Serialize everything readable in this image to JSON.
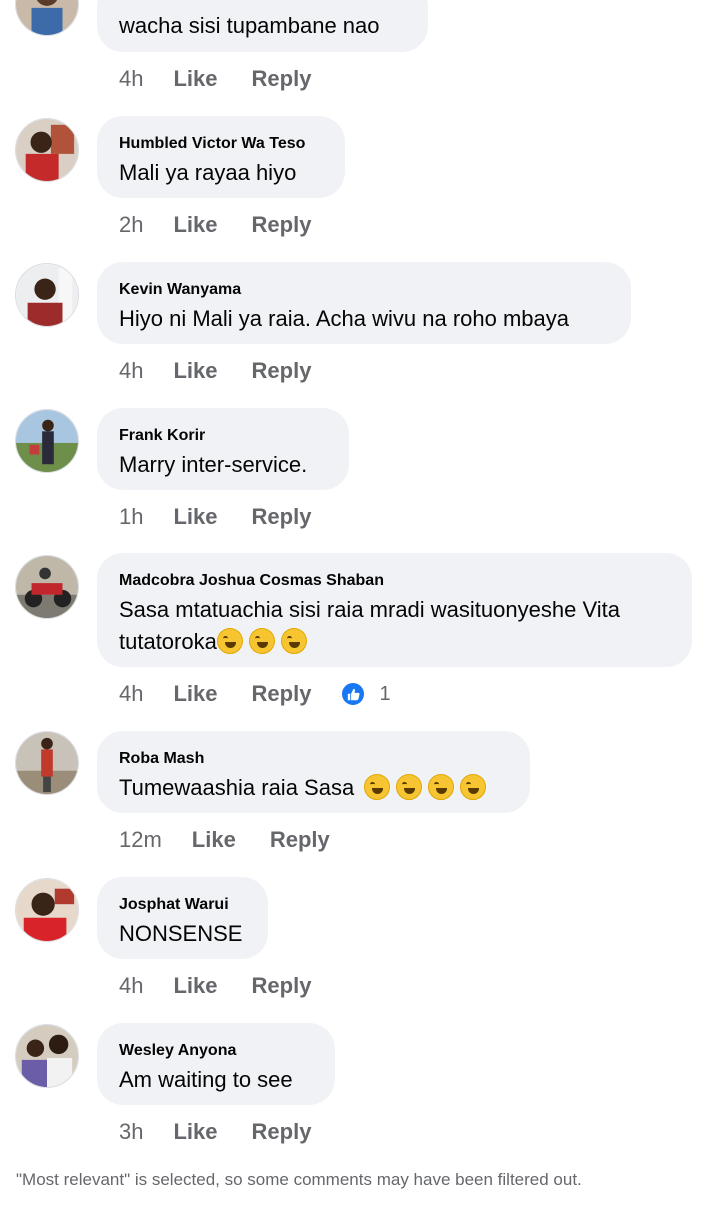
{
  "comments": [
    {
      "author": "",
      "text": "wacha sisi tupambane nao",
      "time": "4h",
      "like": "Like",
      "reply": "Reply"
    },
    {
      "author": "Humbled Victor Wa Teso",
      "text": "Mali ya rayaa hiyo",
      "time": "2h",
      "like": "Like",
      "reply": "Reply"
    },
    {
      "author": "Kevin Wanyama",
      "text": "Hiyo ni Mali ya raia. Acha wivu na roho mbaya",
      "time": "4h",
      "like": "Like",
      "reply": "Reply"
    },
    {
      "author": "Frank Korir",
      "text": "Marry inter-service.",
      "time": "1h",
      "like": "Like",
      "reply": "Reply"
    },
    {
      "author": "Madcobra Joshua Cosmas Shaban",
      "text_line1": "Sasa mtatuachia sisi raia mradi wasituonyeshe Vita",
      "text_line2": "tutatoroka",
      "time": "4h",
      "like": "Like",
      "reply": "Reply",
      "reaction_count": "1"
    },
    {
      "author": "Roba Mash",
      "text": "Tumewaashia raia Sasa",
      "time": "12m",
      "like": "Like",
      "reply": "Reply"
    },
    {
      "author": "Josphat Warui",
      "text": "NONSENSE",
      "time": "4h",
      "like": "Like",
      "reply": "Reply"
    },
    {
      "author": "Wesley Anyona",
      "text": "Am waiting to see",
      "time": "3h",
      "like": "Like",
      "reply": "Reply"
    }
  ],
  "footer": "\"Most relevant\" is selected, so some comments may have been filtered out.",
  "colors": {
    "bubble": "#f0f2f5",
    "muted": "#65676b",
    "like_blue": "#1877f2"
  },
  "icons": {
    "reaction": "like-thumb-icon",
    "emoji": "rolling-laughing-emoji"
  }
}
